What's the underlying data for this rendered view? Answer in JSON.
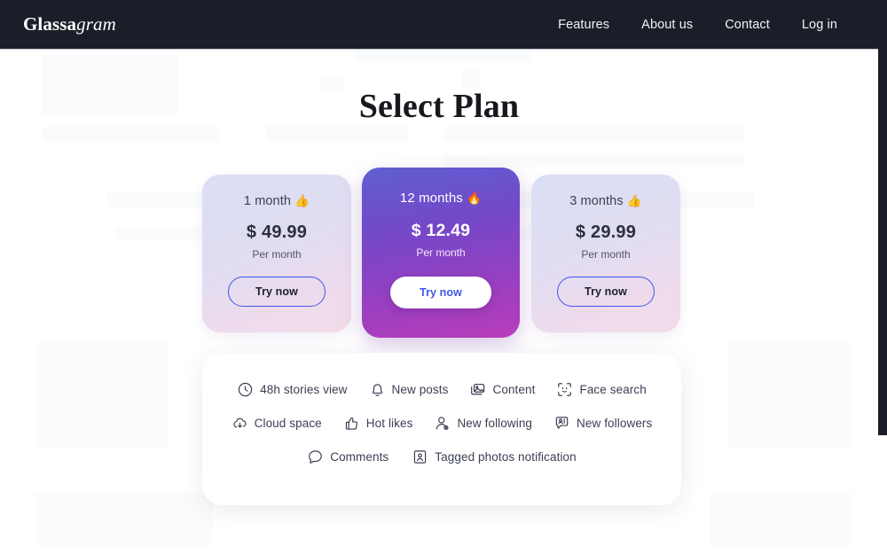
{
  "header": {
    "brand_bold": "Glassa",
    "brand_italic": "gram",
    "nav": [
      {
        "label": "Features",
        "name": "nav-link-features"
      },
      {
        "label": "About us",
        "name": "nav-link-about-us"
      },
      {
        "label": "Contact",
        "name": "nav-link-contact"
      },
      {
        "label": "Log in",
        "name": "nav-link-log-in"
      }
    ],
    "background_color": "#1b1e28"
  },
  "main": {
    "title": "Select Plan"
  },
  "plans": [
    {
      "name": "1 month",
      "emoji": "👍",
      "price": "$ 49.99",
      "period": "Per month",
      "cta": "Try now",
      "featured": false,
      "accent_color": "#3f56e8"
    },
    {
      "name": "12 months",
      "emoji": "🔥",
      "price": "$ 12.49",
      "period": "Per month",
      "cta": "Try now",
      "featured": true,
      "accent_color": "#3f56e8"
    },
    {
      "name": "3 months",
      "emoji": "👍",
      "price": "$ 29.99",
      "period": "Per month",
      "cta": "Try now",
      "featured": false,
      "accent_color": "#3f56e8"
    }
  ],
  "features": {
    "rows": [
      [
        {
          "icon": "clock-icon",
          "label": "48h stories view"
        },
        {
          "icon": "bell-icon",
          "label": "New posts"
        },
        {
          "icon": "image-icon",
          "label": "Content"
        },
        {
          "icon": "face-scan-icon",
          "label": "Face search"
        }
      ],
      [
        {
          "icon": "cloud-download-icon",
          "label": "Cloud space"
        },
        {
          "icon": "thumbs-up-icon",
          "label": "Hot likes"
        },
        {
          "icon": "user-gear-icon",
          "label": "New following"
        },
        {
          "icon": "user-badge-icon",
          "label": "New followers"
        }
      ],
      [
        {
          "icon": "comment-icon",
          "label": "Comments"
        },
        {
          "icon": "user-frame-icon",
          "label": "Tagged photos notification"
        }
      ]
    ]
  },
  "scrollbar": {
    "thumb_color": "#1b1e28"
  }
}
